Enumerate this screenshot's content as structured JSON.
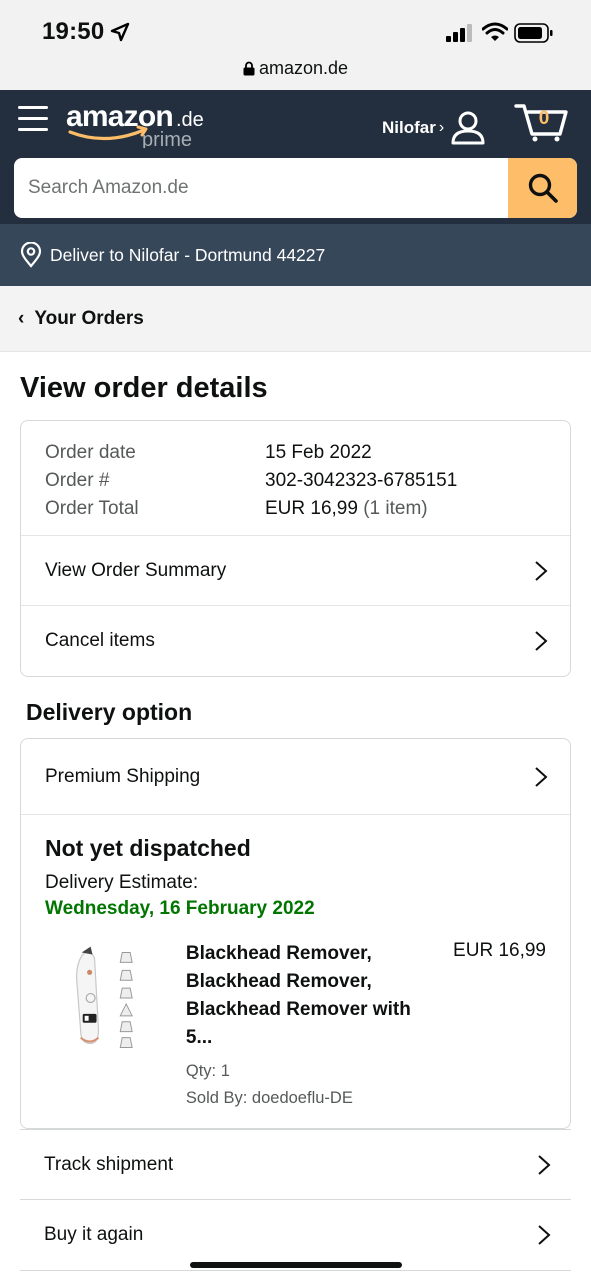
{
  "status_bar": {
    "time": "19:50",
    "url": "amazon.de",
    "icons": [
      "location-arrow-icon",
      "signal-icon",
      "wifi-icon",
      "battery-icon",
      "lock-icon"
    ]
  },
  "header": {
    "logo_text": "amazon.de",
    "logo_sub": "prime",
    "account_name": "Nilofar",
    "account_chevron": "›",
    "cart_count": "0",
    "colors": {
      "header_bg": "#232f3e",
      "deliver_bg": "#37475a",
      "search_button": "#febd69",
      "cart_count": "#febd69"
    }
  },
  "search": {
    "placeholder": "Search Amazon.de"
  },
  "deliver": {
    "text": "Deliver to Nilofar - Dortmund 44227"
  },
  "breadcrumb": {
    "back": "‹",
    "label": "Your Orders"
  },
  "page": {
    "title": "View order details"
  },
  "order": {
    "rows": [
      {
        "key": "Order date",
        "value": "15 Feb 2022",
        "extra": ""
      },
      {
        "key": "Order #",
        "value": "302-3042323-6785151",
        "extra": ""
      },
      {
        "key": "Order Total",
        "value": "EUR 16,99",
        "extra": " (1 item)"
      }
    ],
    "links": [
      "View Order Summary",
      "Cancel items"
    ]
  },
  "delivery": {
    "section_title": "Delivery option",
    "shipping": "Premium Shipping",
    "status": "Not yet dispatched",
    "estimate_label": "Delivery Estimate:",
    "estimate_date": "Wednesday, 16 February 2022",
    "estimate_color": "#007600"
  },
  "item": {
    "title": "Blackhead Remover, Blackhead Remover, Blackhead Remover with 5...",
    "qty": "Qty: 1",
    "seller": "Sold By: doedoeflu-DE",
    "price": "EUR 16,99"
  },
  "actions": [
    "Track shipment",
    "Buy it again"
  ]
}
